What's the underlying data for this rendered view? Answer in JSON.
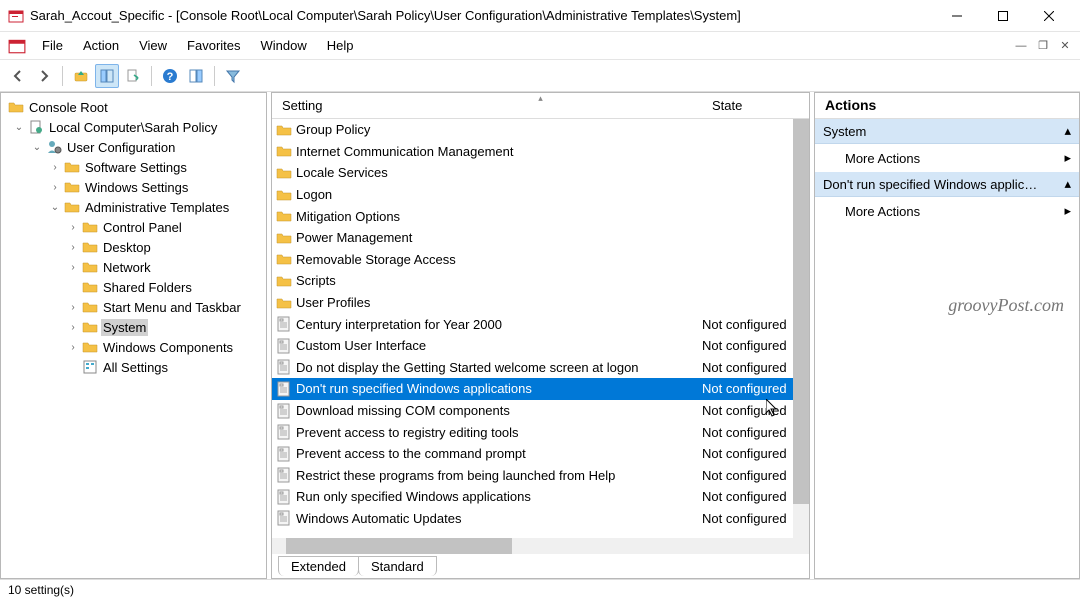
{
  "window": {
    "title": "Sarah_Accout_Specific - [Console Root\\Local Computer\\Sarah Policy\\User Configuration\\Administrative Templates\\System]"
  },
  "menu": [
    "File",
    "Action",
    "View",
    "Favorites",
    "Window",
    "Help"
  ],
  "tree": {
    "root": "Console Root",
    "policy": "Local Computer\\Sarah Policy",
    "uc": "User Configuration",
    "ss": "Software Settings",
    "ws": "Windows Settings",
    "at": "Administrative Templates",
    "cp": "Control Panel",
    "dk": "Desktop",
    "nw": "Network",
    "sf": "Shared Folders",
    "smt": "Start Menu and Taskbar",
    "sys": "System",
    "wc": "Windows Components",
    "as": "All Settings"
  },
  "columns": {
    "setting": "Setting",
    "state": "State"
  },
  "rows": [
    {
      "type": "folder",
      "name": "Group Policy",
      "state": ""
    },
    {
      "type": "folder",
      "name": "Internet Communication Management",
      "state": ""
    },
    {
      "type": "folder",
      "name": "Locale Services",
      "state": ""
    },
    {
      "type": "folder",
      "name": "Logon",
      "state": ""
    },
    {
      "type": "folder",
      "name": "Mitigation Options",
      "state": ""
    },
    {
      "type": "folder",
      "name": "Power Management",
      "state": ""
    },
    {
      "type": "folder",
      "name": "Removable Storage Access",
      "state": ""
    },
    {
      "type": "folder",
      "name": "Scripts",
      "state": ""
    },
    {
      "type": "folder",
      "name": "User Profiles",
      "state": ""
    },
    {
      "type": "policy",
      "name": "Century interpretation for Year 2000",
      "state": "Not configured"
    },
    {
      "type": "policy",
      "name": "Custom User Interface",
      "state": "Not configured"
    },
    {
      "type": "policy",
      "name": "Do not display the Getting Started welcome screen at logon",
      "state": "Not configured"
    },
    {
      "type": "policy",
      "name": "Don't run specified Windows applications",
      "state": "Not configured",
      "selected": true
    },
    {
      "type": "policy",
      "name": "Download missing COM components",
      "state": "Not configured"
    },
    {
      "type": "policy",
      "name": "Prevent access to registry editing tools",
      "state": "Not configured"
    },
    {
      "type": "policy",
      "name": "Prevent access to the command prompt",
      "state": "Not configured"
    },
    {
      "type": "policy",
      "name": "Restrict these programs from being launched from Help",
      "state": "Not configured"
    },
    {
      "type": "policy",
      "name": "Run only specified Windows applications",
      "state": "Not configured"
    },
    {
      "type": "policy",
      "name": "Windows Automatic Updates",
      "state": "Not configured"
    }
  ],
  "tabs": {
    "extended": "Extended",
    "standard": "Standard"
  },
  "actions": {
    "header": "Actions",
    "group1": "System",
    "more1": "More Actions",
    "group2": "Don't run specified Windows applicat...",
    "more2": "More Actions"
  },
  "status": "10 setting(s)",
  "watermark": "groovyPost.com"
}
